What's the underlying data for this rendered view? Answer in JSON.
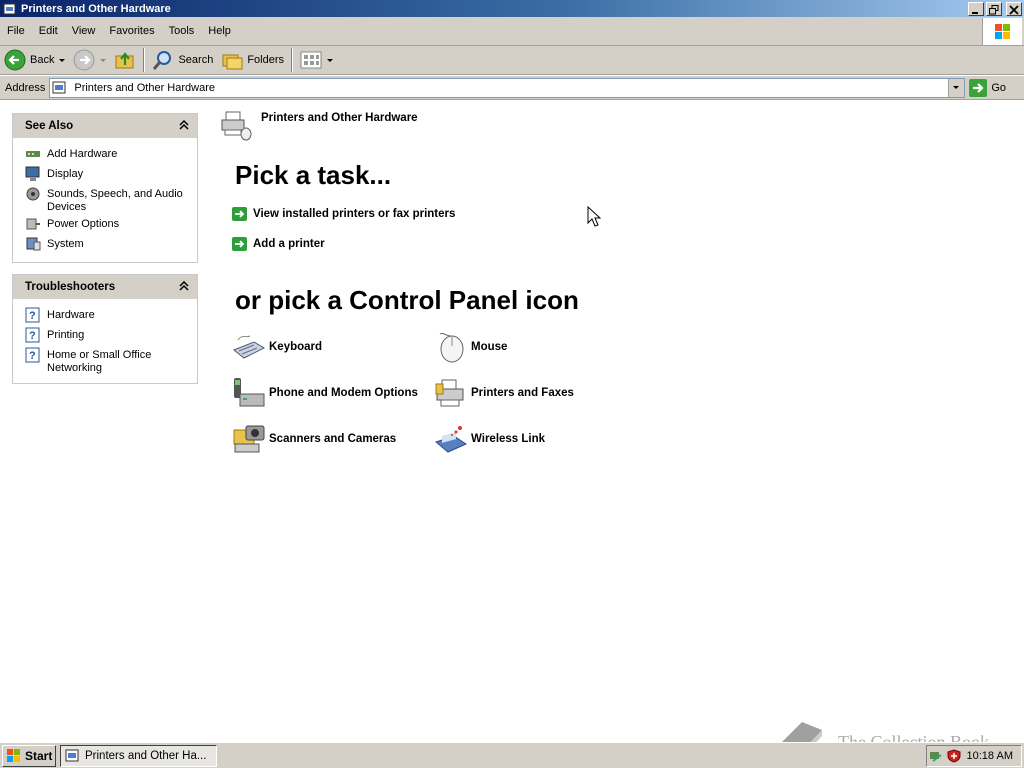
{
  "window": {
    "title": "Printers and Other Hardware"
  },
  "menubar": {
    "items": [
      "File",
      "Edit",
      "View",
      "Favorites",
      "Tools",
      "Help"
    ]
  },
  "toolbar": {
    "back_label": "Back",
    "search_label": "Search",
    "folders_label": "Folders"
  },
  "address": {
    "label": "Address",
    "value": "Printers and Other Hardware",
    "go_label": "Go"
  },
  "see_also": {
    "title": "See Also",
    "items": [
      {
        "label": "Add Hardware",
        "icon": "add-hardware-icon"
      },
      {
        "label": "Display",
        "icon": "display-icon"
      },
      {
        "label": "Sounds, Speech, and Audio Devices",
        "icon": "sounds-icon"
      },
      {
        "label": "Power Options",
        "icon": "power-options-icon"
      },
      {
        "label": "System",
        "icon": "system-icon"
      }
    ]
  },
  "troubleshooters": {
    "title": "Troubleshooters",
    "items": [
      {
        "label": "Hardware",
        "icon": "help-icon"
      },
      {
        "label": "Printing",
        "icon": "help-icon"
      },
      {
        "label": "Home or Small Office Networking",
        "icon": "help-icon"
      }
    ]
  },
  "main": {
    "category_title": "Printers and Other Hardware",
    "pick_task": "Pick a task...",
    "tasks": [
      "View installed printers or fax printers",
      "Add a printer"
    ],
    "pick_icon": "or pick a Control Panel icon",
    "icons": [
      {
        "label": "Keyboard",
        "icon": "keyboard-icon"
      },
      {
        "label": "Mouse",
        "icon": "mouse-icon"
      },
      {
        "label": "Phone and Modem Options",
        "icon": "phone-modem-icon"
      },
      {
        "label": "Printers and Faxes",
        "icon": "printer-icon"
      },
      {
        "label": "Scanners and Cameras",
        "icon": "scanner-camera-icon"
      },
      {
        "label": "Wireless Link",
        "icon": "wireless-link-icon"
      }
    ]
  },
  "watermark": {
    "text": "The Collection Book"
  },
  "taskbar": {
    "start_label": "Start",
    "task_label": "Printers and Other Ha...",
    "clock": "10:18 AM"
  }
}
